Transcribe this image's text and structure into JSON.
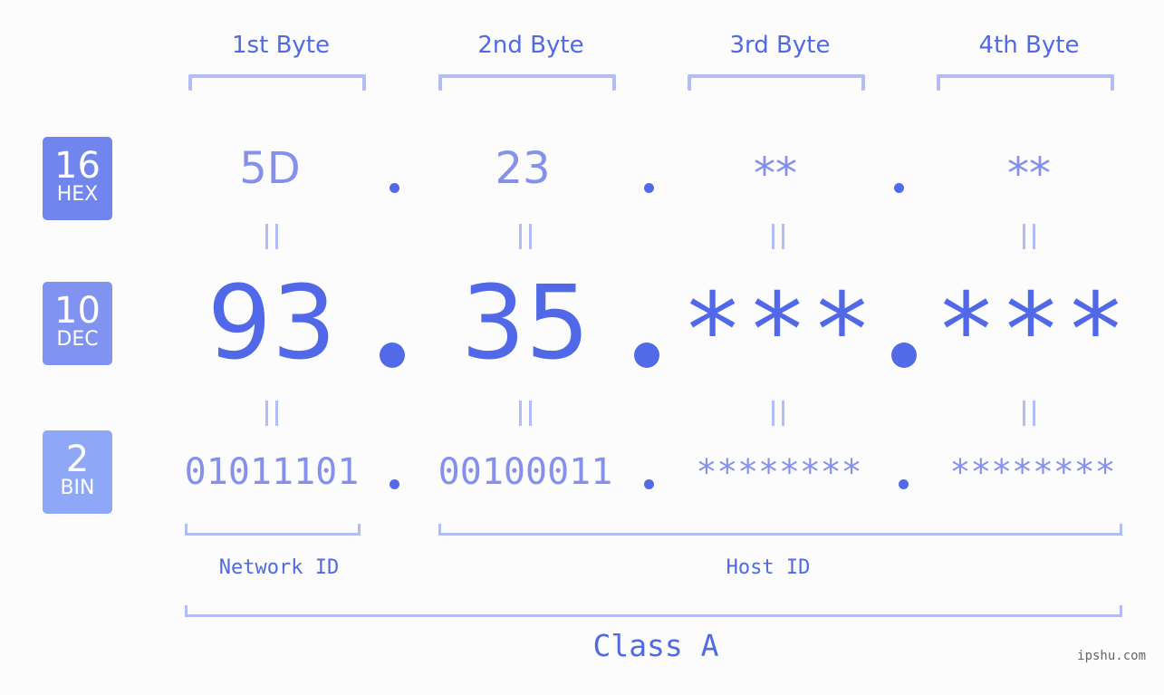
{
  "ip_display": {
    "byte_headers": [
      "1st Byte",
      "2nd Byte",
      "3rd Byte",
      "4th Byte"
    ],
    "badges": {
      "hex": {
        "number": "16",
        "label": "HEX"
      },
      "dec": {
        "number": "10",
        "label": "DEC"
      },
      "bin": {
        "number": "2",
        "label": "BIN"
      }
    },
    "hex": [
      "5D",
      "23",
      "**",
      "**"
    ],
    "dec": [
      "93",
      "35",
      "***",
      "***"
    ],
    "bin": [
      "01011101",
      "00100011",
      "********",
      "********"
    ],
    "network_id_label": "Network ID",
    "host_id_label": "Host ID",
    "class_label": "Class A",
    "watermark": "ipshu.com"
  },
  "colors": {
    "accent": "#5169e3",
    "hex_badge": "#7185ee",
    "dec_badge": "#8193f1",
    "bin_badge": "#8ea8f7",
    "bracket": "#b2bdf6",
    "light_value": "#8490ec"
  }
}
